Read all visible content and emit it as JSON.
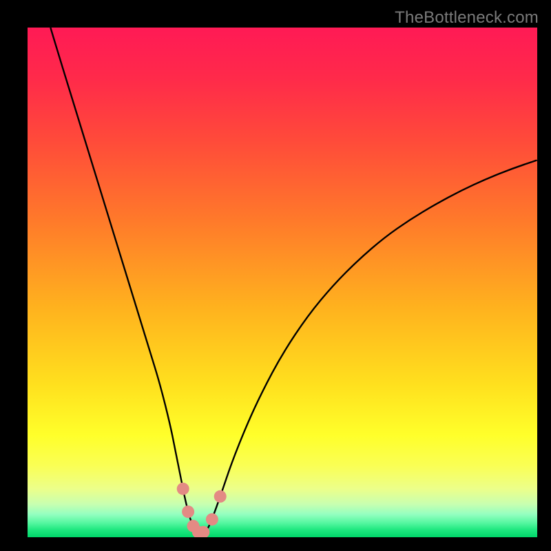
{
  "watermark": "TheBottleneck.com",
  "colors": {
    "background": "#000000",
    "gradient_stops": [
      {
        "offset": 0.0,
        "color": "#ff1a55"
      },
      {
        "offset": 0.1,
        "color": "#ff2a4a"
      },
      {
        "offset": 0.22,
        "color": "#ff4a3a"
      },
      {
        "offset": 0.38,
        "color": "#ff7a2a"
      },
      {
        "offset": 0.55,
        "color": "#ffb21e"
      },
      {
        "offset": 0.7,
        "color": "#ffe01e"
      },
      {
        "offset": 0.8,
        "color": "#ffff2a"
      },
      {
        "offset": 0.86,
        "color": "#faff55"
      },
      {
        "offset": 0.905,
        "color": "#ecff8a"
      },
      {
        "offset": 0.935,
        "color": "#c8ffb0"
      },
      {
        "offset": 0.955,
        "color": "#94ffc0"
      },
      {
        "offset": 0.972,
        "color": "#55f7a0"
      },
      {
        "offset": 0.985,
        "color": "#20e880"
      },
      {
        "offset": 1.0,
        "color": "#00d66a"
      }
    ],
    "curve": "#000000",
    "marker": "#e38a84"
  },
  "chart_data": {
    "type": "line",
    "title": "",
    "xlabel": "",
    "ylabel": "",
    "xlim": [
      0,
      100
    ],
    "ylim": [
      0,
      100
    ],
    "series": [
      {
        "name": "bottleneck-curve",
        "x": [
          4.5,
          6,
          8,
          10,
          12,
          14,
          16,
          18,
          20,
          22,
          24,
          26,
          28,
          29,
          30,
          31,
          32,
          33,
          34,
          35,
          36,
          38,
          40,
          43,
          46,
          50,
          55,
          60,
          65,
          70,
          75,
          80,
          85,
          90,
          95,
          100
        ],
        "values": [
          100,
          95,
          88.5,
          82,
          75.5,
          69,
          62.5,
          56,
          49.5,
          43,
          36.5,
          30,
          22,
          17,
          12,
          7,
          3.2,
          1.2,
          0.5,
          1.0,
          3.0,
          8.5,
          14.5,
          22,
          28.5,
          36,
          43.5,
          49.5,
          54.5,
          58.8,
          62.3,
          65.3,
          68,
          70.3,
          72.3,
          74
        ]
      }
    ],
    "markers": [
      {
        "x": 30.5,
        "y": 9.5
      },
      {
        "x": 31.5,
        "y": 5.0
      },
      {
        "x": 32.5,
        "y": 2.2
      },
      {
        "x": 33.5,
        "y": 1.0
      },
      {
        "x": 34.5,
        "y": 1.0
      },
      {
        "x": 36.2,
        "y": 3.5
      },
      {
        "x": 37.8,
        "y": 8.0
      }
    ]
  }
}
